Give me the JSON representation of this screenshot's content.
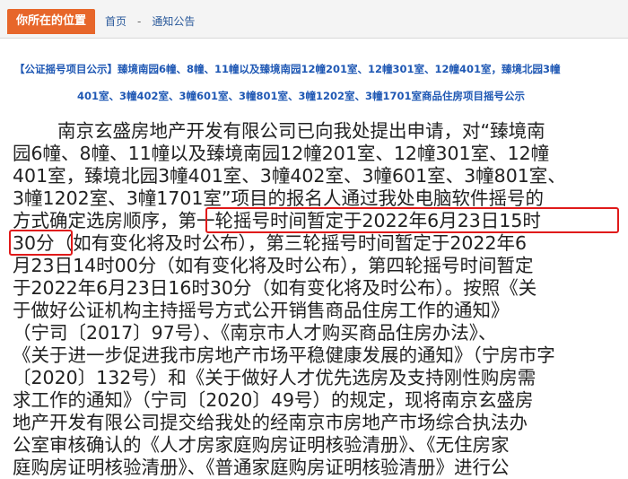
{
  "header": {
    "location_label": "你所在的位置",
    "breadcrumb_home": "首页",
    "breadcrumb_sep": "-",
    "breadcrumb_current": "通知公告"
  },
  "notice": {
    "title_line1": "【公证摇号项目公示】臻境南园6幢、8幢、11幢以及臻境南园12幢201室、12幢301室、12幢401室，臻境北园3幢",
    "title_line2": "401室、3幢402室、3幢601室、3幢801室、3幢1202室、3幢1701室商品住房项目摇号公示",
    "body_lines": [
      "南京玄盛房地产开发有限公司已向我处提出申请，对“臻境南",
      "园6幢、8幢、11幢以及臻境南园12幢201室、12幢301室、12幢",
      "401室，臻境北园3幢401室、3幢402室、3幢601室、3幢801室、",
      "3幢1202室、3幢1701室”项目的报名人通过我处电脑软件摇号的",
      "方式确定选房顺序，第一轮摇号时间暂定于2022年6月23日15时",
      "30分（如有变化将及时公布），第三轮摇号时间暂定于2022年6",
      "月23日14时00分（如有变化将及时公布），第四轮摇号时间暂定",
      "于2022年6月23日16时30分（如有变化将及时公布）。按照《关",
      "于做好公证机构主持摇号方式公开销售商品住房工作的通知》",
      "（宁司〔2017〕97号）、《南京市人才购买商品住房办法》、",
      "《关于进一步促进我市房地产市场平稳健康发展的通知》（宁房市字",
      "〔2020〕132号）和《关于做好人才优先选房及支持刚性购房需",
      "求工作的通知》（宁司〔2020〕49号）的规定，现将南京玄盛房",
      "地产开发有限公司提交给我处的经南京市房地产市场综合执法办",
      "公室审核确认的《人才房家庭购房证明核验清册》、《无住房家",
      "庭购房证明核验清册》、《普通家庭购房证明核验清册》进行公"
    ]
  },
  "colors": {
    "accent": "#e7662a",
    "link": "#2b5a9b",
    "title": "#1f58b4",
    "highlight": "#e01a1a"
  }
}
